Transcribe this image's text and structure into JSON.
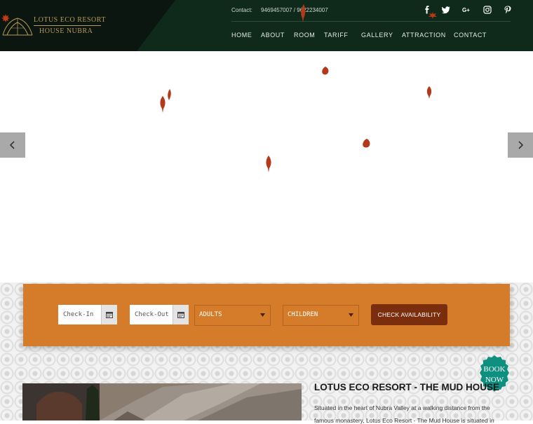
{
  "header": {
    "logo": {
      "line1": "LOTUS ECO RESORT",
      "line2": "HOUSE  NUBRA"
    },
    "contact_label": "Contact:",
    "contact_numbers": "9469457007 / 9622234007",
    "social": [
      "facebook-icon",
      "twitter-icon",
      "google-plus-icon",
      "instagram-icon",
      "pinterest-icon"
    ],
    "nav": [
      "HOME",
      "ABOUT",
      "ROOM",
      "TARIFF",
      "GALLERY",
      "ATTRACTION",
      "CONTACT"
    ]
  },
  "booking": {
    "checkin_placeholder": "Check-In",
    "checkout_placeholder": "Check-Out",
    "adults": "ADULTS",
    "children": "CHILDREN",
    "submit": "CHECK AVAILABILITY"
  },
  "about": {
    "title": "LOTUS ECO RESORT - THE MUD HOUSE",
    "text": "Situated in the heart of Nubra Valley at a walking distance from the",
    "text2": "famous monastery, Lotus Eco Resort - The Mud House is situated in"
  },
  "badge": {
    "line1": "BOOK",
    "line2": "NOW"
  },
  "colors": {
    "header_bg": "#0f2a1b",
    "booking_bg": "#d57c2a",
    "button_bg": "#7a2e0d",
    "leaf": "#b4381a",
    "badge": "#0f8f7f"
  }
}
